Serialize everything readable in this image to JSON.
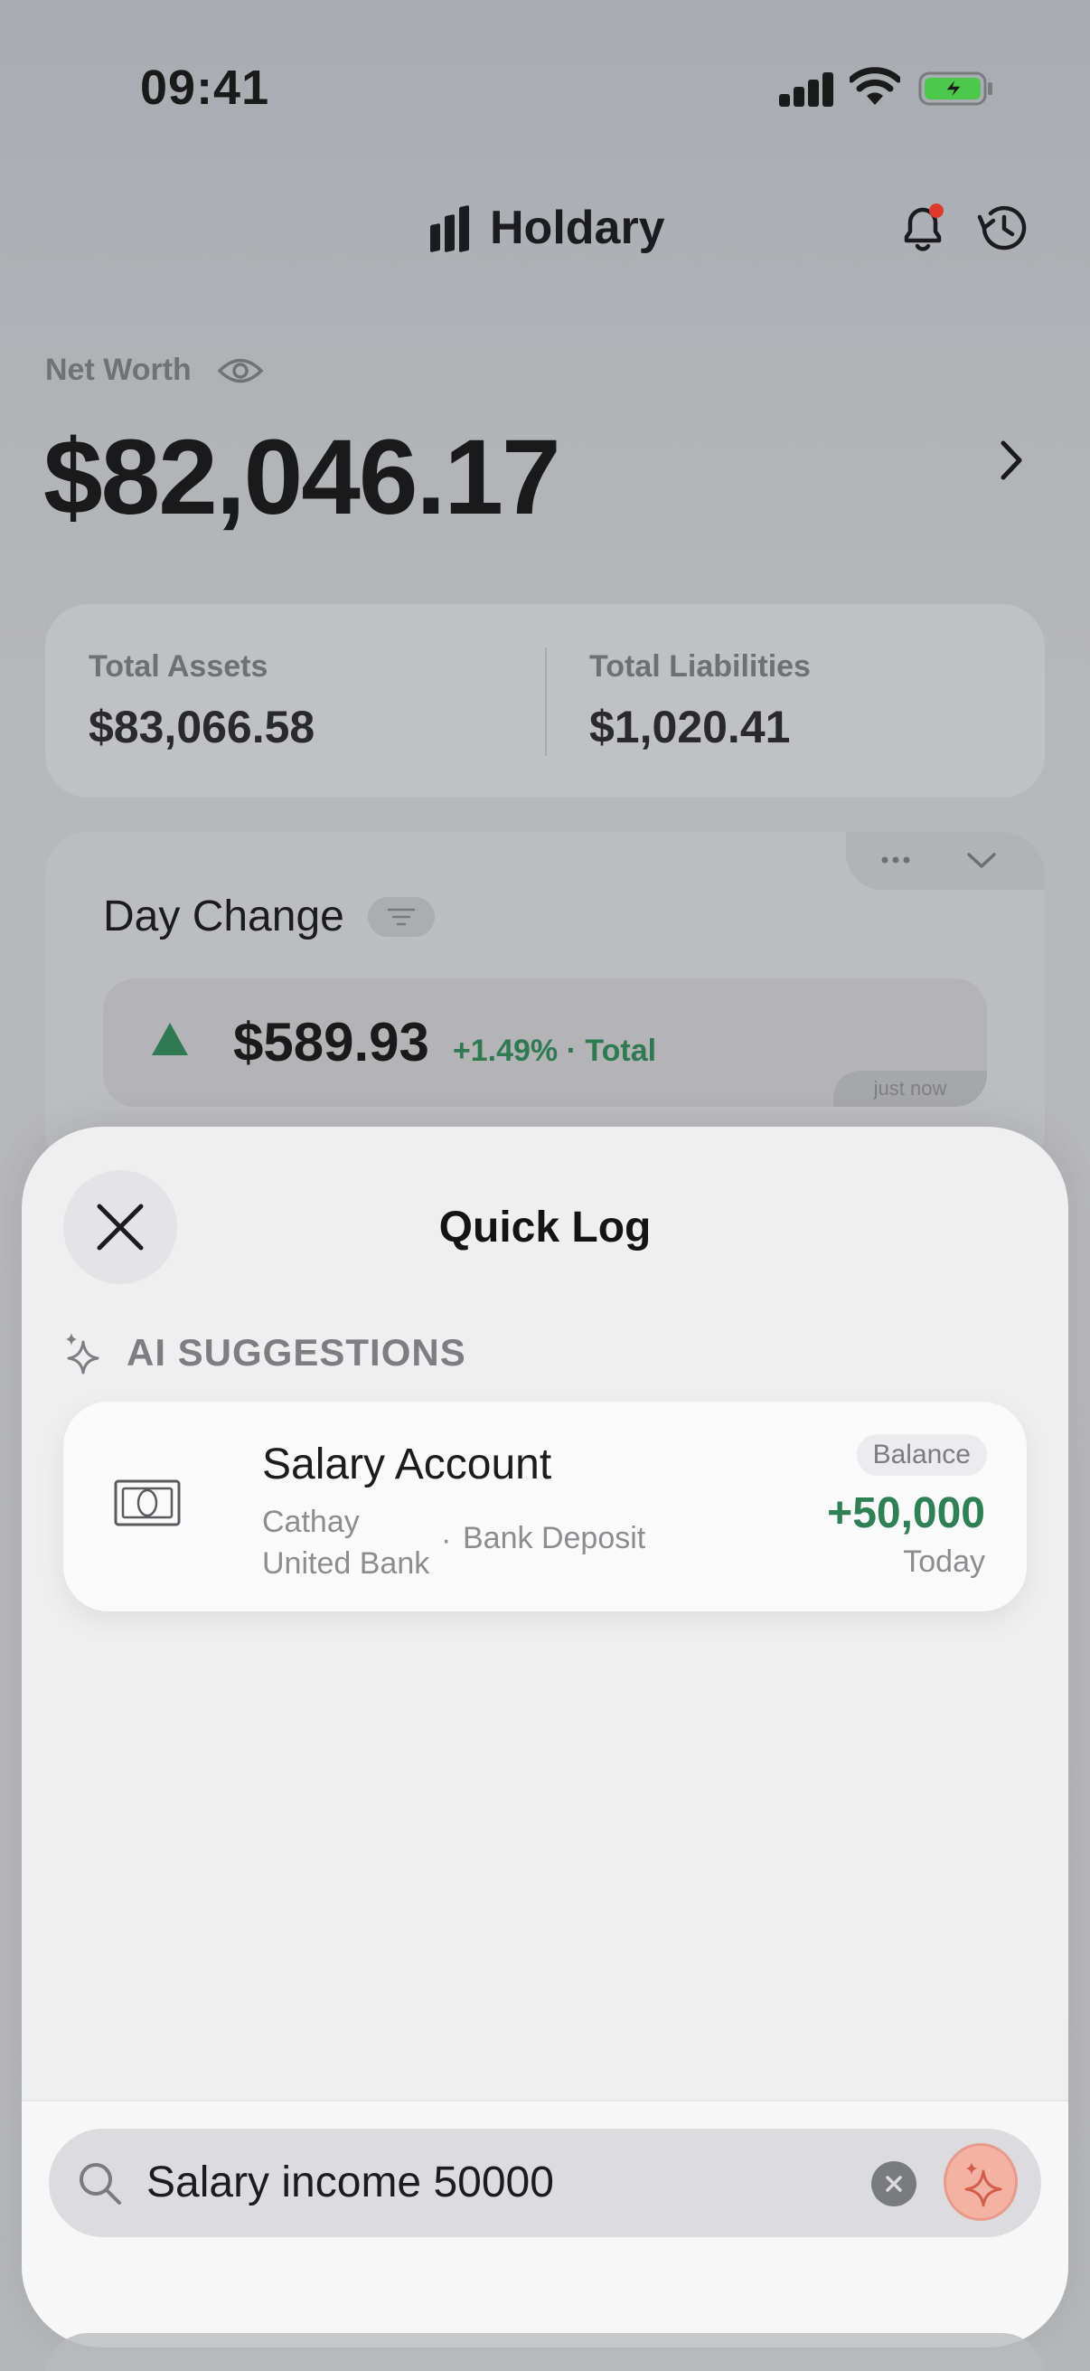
{
  "status": {
    "time": "09:41"
  },
  "header": {
    "app_name": "Holdary"
  },
  "net_worth": {
    "label": "Net Worth",
    "value": "$82,046.17"
  },
  "totals": {
    "assets_label": "Total Assets",
    "assets_value": "$83,066.58",
    "liabilities_label": "Total Liabilities",
    "liabilities_value": "$1,020.41"
  },
  "day_change": {
    "title": "Day Change",
    "amount": "$589.93",
    "percent": "+1.49% · Total",
    "updated": "just now"
  },
  "sheet": {
    "title": "Quick Log",
    "ai_label": "AI SUGGESTIONS",
    "suggestion": {
      "name": "Salary Account",
      "bank_line1": "Cathay",
      "bank_line2": "United Bank",
      "separator": "·",
      "type": "Bank Deposit",
      "badge": "Balance",
      "amount": "+50,000",
      "date": "Today"
    },
    "search_value": "Salary income 50000"
  },
  "colors": {
    "positive": "#2f8055",
    "ai_accent": "#f3b2a4",
    "notification": "#e03a2f"
  },
  "icons": [
    "bars-logo-icon",
    "bell-icon",
    "history-icon",
    "eye-icon",
    "chevron-right-icon",
    "more-icon",
    "chevron-down-icon",
    "filter-icon",
    "triangle-up-icon",
    "close-icon",
    "sparkle-icon",
    "cash-icon",
    "search-icon",
    "clear-icon",
    "ai-sparkle-icon"
  ]
}
